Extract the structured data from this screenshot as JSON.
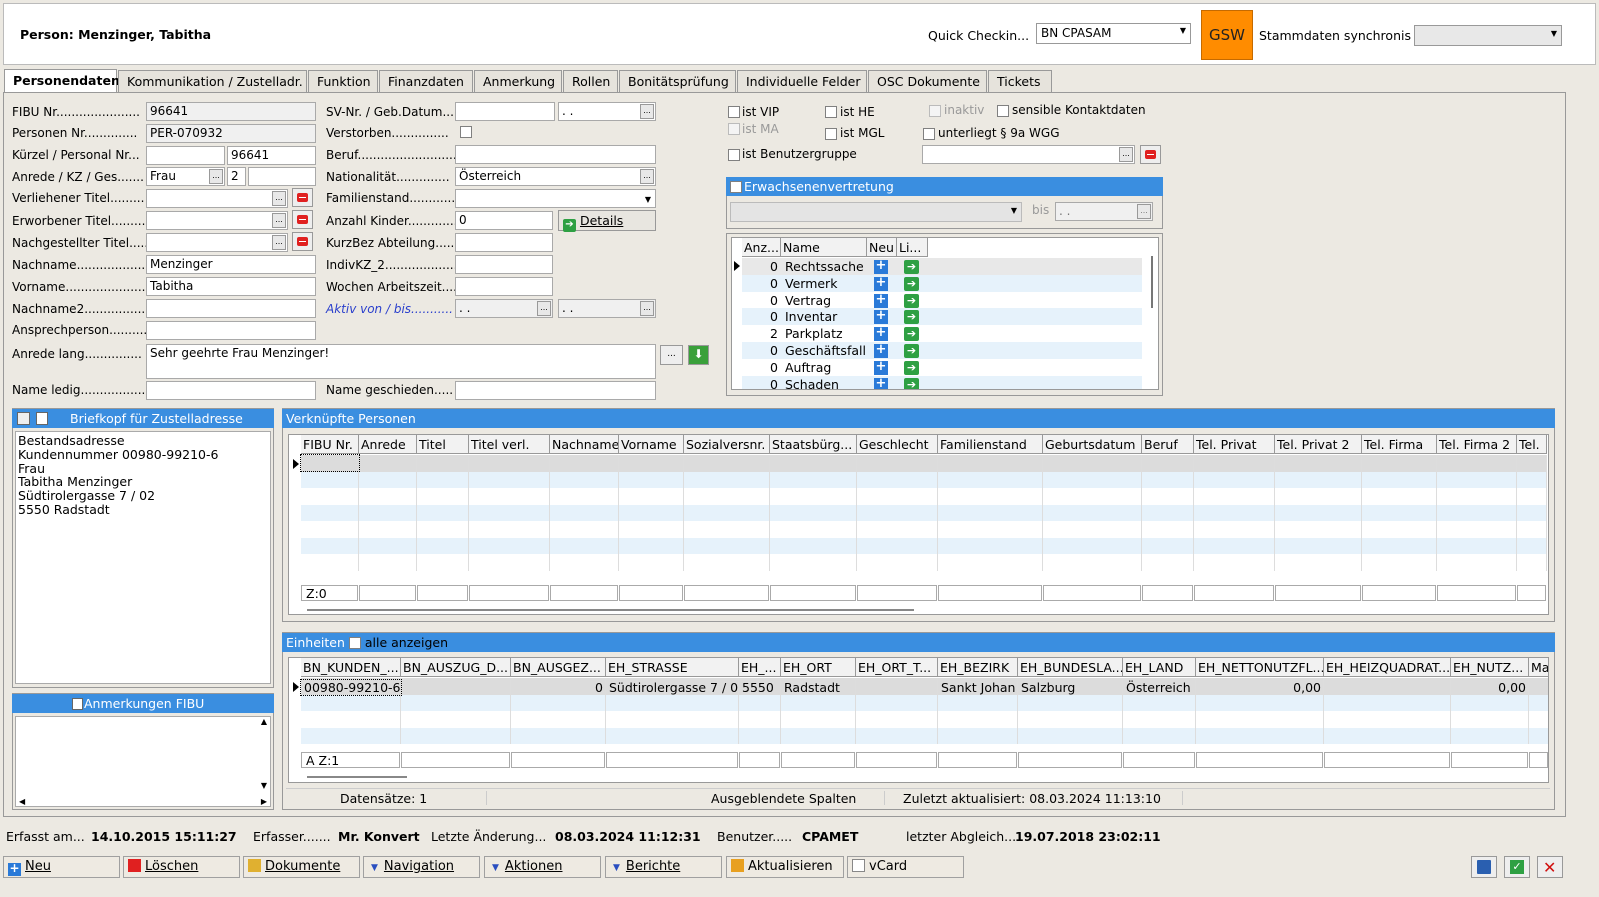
{
  "header": {
    "title": "Person: Menzinger, Tabitha",
    "quick_checkin_label": "Quick Checkin...",
    "quick_checkin_value": "BN CPASAM",
    "logo_text": "GSW",
    "sync_label": "Stammdaten synchronis",
    "sync_value": ""
  },
  "tabs": [
    {
      "label": "Personendaten"
    },
    {
      "label": "Kommunikation / Zustelladr."
    },
    {
      "label": "Funktion"
    },
    {
      "label": "Finanzdaten"
    },
    {
      "label": "Anmerkung"
    },
    {
      "label": "Rollen"
    },
    {
      "label": "Bonitätsprüfung"
    },
    {
      "label": "Individuelle Felder"
    },
    {
      "label": "OSC Dokumente"
    },
    {
      "label": "Tickets"
    }
  ],
  "form_left": {
    "fibu_label": "FIBU Nr......................",
    "fibu": "96641",
    "personen_label": "Personen Nr..............",
    "personen": "PER-070932",
    "kuerzel_label": "Kürzel / Personal Nr...",
    "kuerzel": "",
    "personal_nr": "96641",
    "anrede_label": "Anrede / KZ / Ges.......",
    "anrede": "Frau",
    "kz": "2",
    "ges": "",
    "verl_titel_label": "Verliehener Titel.........",
    "verl_titel": "",
    "erw_titel_label": "Erworbener Titel..........",
    "erw_titel": "",
    "nach_titel_label": "Nachgestellter Titel.....",
    "nach_titel": "",
    "nachname_label": "Nachname...................",
    "nachname": "Menzinger",
    "vorname_label": "Vorname.....................",
    "vorname": "Tabitha",
    "nachname2_label": "Nachname2..................",
    "nachname2": "",
    "ansprech_label": "Ansprechperson..........",
    "ansprech": "",
    "anrede_lang_label": "Anrede lang...............",
    "anrede_lang": "Sehr geehrte Frau Menzinger!",
    "name_ledig_label": "Name ledig..................",
    "name_ledig": ""
  },
  "form_mid": {
    "sv_label": "SV-Nr. / Geb.Datum....",
    "sv": "",
    "geb": " .  .",
    "verstorben_label": "Verstorben...............",
    "beruf_label": "Beruf..........................",
    "beruf": "",
    "nationalitaet_label": "Nationalität..............",
    "nationalitaet": "Österreich",
    "familienstand_label": "Familienstand.............",
    "familienstand": "",
    "kinder_label": "Anzahl Kinder.............",
    "kinder": "0",
    "details_label": "Details",
    "kurzbez_label": "KurzBez Abteilung.....",
    "kurzbez": "",
    "indivkz_label": "IndivKZ_2...................",
    "indivkz": "",
    "wochen_label": "Wochen Arbeitszeit.....",
    "wochen": "",
    "aktiv_label": "Aktiv von / bis...........",
    "aktiv_von": " .  .",
    "aktiv_bis": " .  .",
    "name_gesch_label": "Name geschieden.....",
    "name_gesch": ""
  },
  "flags": {
    "vip": "ist VIP",
    "he": "ist HE",
    "inaktiv": "inaktiv",
    "sensible": "sensible Kontaktdaten",
    "ma": "ist MA",
    "mgl": "ist MGL",
    "wgg": "unterliegt § 9a WGG",
    "benutzergruppe": "ist Benutzergruppe"
  },
  "erwachsenen": {
    "title": "Erwachsenenvertretung",
    "bis_label": "bis",
    "bis_value": " .  ."
  },
  "counts": {
    "headers": [
      "Anz...",
      "Name",
      "Neu",
      "Li..."
    ],
    "rows": [
      {
        "anz": "0",
        "name": "Rechtssache"
      },
      {
        "anz": "0",
        "name": "Vermerk"
      },
      {
        "anz": "0",
        "name": "Vertrag"
      },
      {
        "anz": "0",
        "name": "Inventar"
      },
      {
        "anz": "2",
        "name": "Parkplatz"
      },
      {
        "anz": "0",
        "name": "Geschäftsfall"
      },
      {
        "anz": "0",
        "name": "Auftrag"
      },
      {
        "anz": "0",
        "name": "Schaden"
      }
    ]
  },
  "briefkopf": {
    "title": "Briefkopf für Zustelladresse",
    "lines": [
      "Bestandsadresse",
      "Kundennummer 00980-99210-6",
      "Frau",
      "Tabitha Menzinger",
      "Südtirolergasse 7 / 02",
      "5550 Radstadt"
    ]
  },
  "anmerkungen": {
    "title": "Anmerkungen FIBU"
  },
  "verknuepfte": {
    "title": "Verknüpfte Personen",
    "headers": [
      "FIBU Nr.",
      "Anrede",
      "Titel",
      "Titel verl.",
      "Nachname",
      "Vorname",
      "Sozialversnr.",
      "Staatsbürg...",
      "Geschlecht",
      "Familienstand",
      "Geburtsdatum",
      "Beruf",
      "Tel. Privat",
      "Tel. Privat 2",
      "Tel. Firma",
      "Tel. Firma 2",
      "Tel."
    ],
    "footer": "Z:0"
  },
  "einheiten": {
    "title": "Einheiten",
    "alle_label": "alle anzeigen",
    "headers": [
      "BN_KUNDEN_...",
      "BN_AUSZUG_D...",
      "BN_AUSGEZ...",
      "EH_STRASSE",
      "EH_...",
      "EH_ORT",
      "EH_ORT_T...",
      "EH_BEZIRK",
      "EH_BUNDESLA...",
      "EH_LAND",
      "EH_NETTONUTZFL...",
      "EH_HEIZQUADRAT...",
      "EH_NUTZ...",
      "Ma"
    ],
    "row": [
      "00980-99210-6",
      "",
      "0",
      "Südtirolergasse 7 / 0",
      "5550",
      "Radstadt",
      "",
      "Sankt Johan",
      "Salzburg",
      "Österreich",
      "0,00",
      "",
      "0,00",
      ""
    ],
    "footer": "A Z:1",
    "status": {
      "datensaetze": "Datensätze: 1",
      "ausgeblendet": "Ausgeblendete Spalten",
      "zuletzt": "Zuletzt aktualisiert: 08.03.2024 11:13:10"
    }
  },
  "info": {
    "erfasst_label": "Erfasst am...",
    "erfasst": "14.10.2015 15:11:27",
    "erfasser_label": "Erfasser.......",
    "erfasser": "Mr. Konvert",
    "aenderung_label": "Letzte Änderung...",
    "aenderung": "08.03.2024 11:12:31",
    "benutzer_label": "Benutzer.....",
    "benutzer": "CPAMET",
    "abgleich_label": "letzter Abgleich...",
    "abgleich": "19.07.2018 23:02:11"
  },
  "buttons": {
    "neu": "Neu",
    "loeschen": "Löschen",
    "dokumente": "Dokumente",
    "navigation": "Navigation",
    "aktionen": "Aktionen",
    "berichte": "Berichte",
    "aktualisieren": "Aktualisieren",
    "vcard": "vCard"
  },
  "colors": {
    "accent": "#3a8ee0",
    "logo_bg": "#ff8c00",
    "row_alt": "#e6f2fb"
  }
}
